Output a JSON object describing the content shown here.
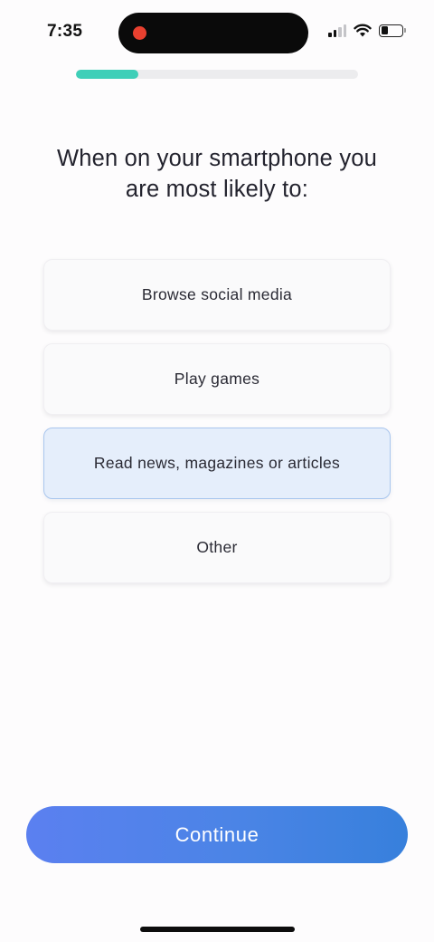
{
  "status_bar": {
    "time": "7:35",
    "icons": [
      "recording-dot-icon",
      "cellular-signal-icon",
      "wifi-icon",
      "battery-icon"
    ]
  },
  "progress": {
    "fraction": 0.22,
    "color": "#3fcfb8",
    "track_color": "#ececee"
  },
  "question": {
    "line1": "When on your smartphone you",
    "line2": "are most likely to:"
  },
  "options": [
    {
      "label": "Browse social media",
      "selected": false
    },
    {
      "label": "Play games",
      "selected": false
    },
    {
      "label": "Read news, magazines or articles",
      "selected": true
    },
    {
      "label": "Other",
      "selected": false
    }
  ],
  "continue_button": {
    "label": "Continue"
  },
  "colors": {
    "accent": "#4b84e6",
    "selected_bg": "#e5eefb",
    "selected_border": "#a9c6ee",
    "recording": "#e8402f"
  }
}
